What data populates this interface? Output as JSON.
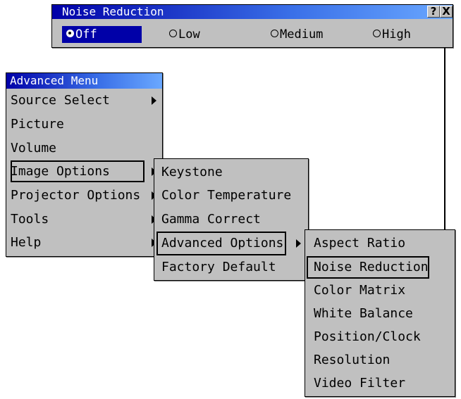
{
  "noise_dialog": {
    "title": "Noise Reduction",
    "help_btn": "?",
    "close_btn": "X",
    "options": [
      {
        "label": "Off",
        "selected": true
      },
      {
        "label": "Low",
        "selected": false
      },
      {
        "label": "Medium",
        "selected": false
      },
      {
        "label": "High",
        "selected": false
      }
    ]
  },
  "advanced_menu": {
    "title": "Advanced Menu",
    "items": [
      "Source Select",
      "Picture",
      "Volume",
      "Image Options",
      "Projector Options",
      "Tools",
      "Help"
    ]
  },
  "image_options_menu": {
    "items": [
      "Keystone",
      "Color Temperature",
      "Gamma Correct",
      "Advanced Options",
      "Factory Default"
    ]
  },
  "advanced_options_menu": {
    "items": [
      "Aspect Ratio",
      "Noise Reduction",
      "Color Matrix",
      "White Balance",
      "Position/Clock",
      "Resolution",
      "Video Filter"
    ]
  },
  "colors": {
    "titlebar_start": "#0000a8",
    "titlebar_end": "#6aa8ff",
    "menu_bg": "#c0c0c0",
    "selected_bg": "#0000a8"
  }
}
